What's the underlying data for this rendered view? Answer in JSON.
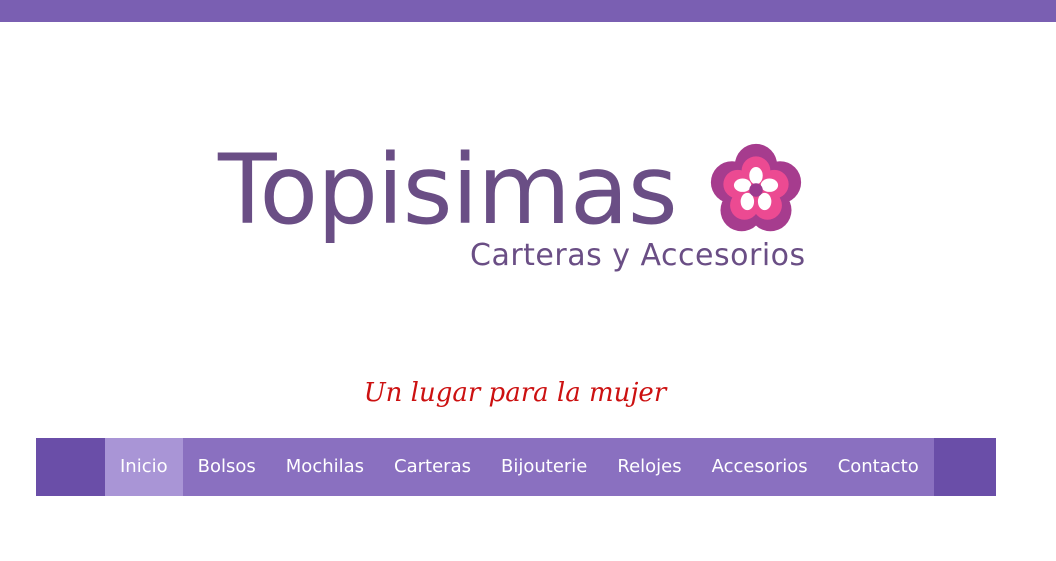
{
  "header": {
    "brand_title": "Topisimas",
    "brand_subtitle": "Carteras y Accesorios",
    "tagline": "Un lugar para la mujer",
    "logo_icon": "flower-icon"
  },
  "nav": {
    "items": [
      {
        "label": "Inicio",
        "active": true
      },
      {
        "label": "Bolsos",
        "active": false
      },
      {
        "label": "Mochilas",
        "active": false
      },
      {
        "label": "Carteras",
        "active": false
      },
      {
        "label": "Bijouterie",
        "active": false
      },
      {
        "label": "Relojes",
        "active": false
      },
      {
        "label": "Accesorios",
        "active": false
      },
      {
        "label": "Contacto",
        "active": false
      }
    ]
  },
  "colors": {
    "topbar": "#7a5fb2",
    "brand_text": "#6a4e85",
    "tagline": "#cc1111",
    "nav_bg": "#6a4ea8",
    "nav_items_bg": "#8a70c0",
    "nav_active_bg": "#a995d6",
    "flower_outer": "#b03a8c",
    "flower_mid": "#e8418c",
    "flower_inner": "#ffffff"
  }
}
